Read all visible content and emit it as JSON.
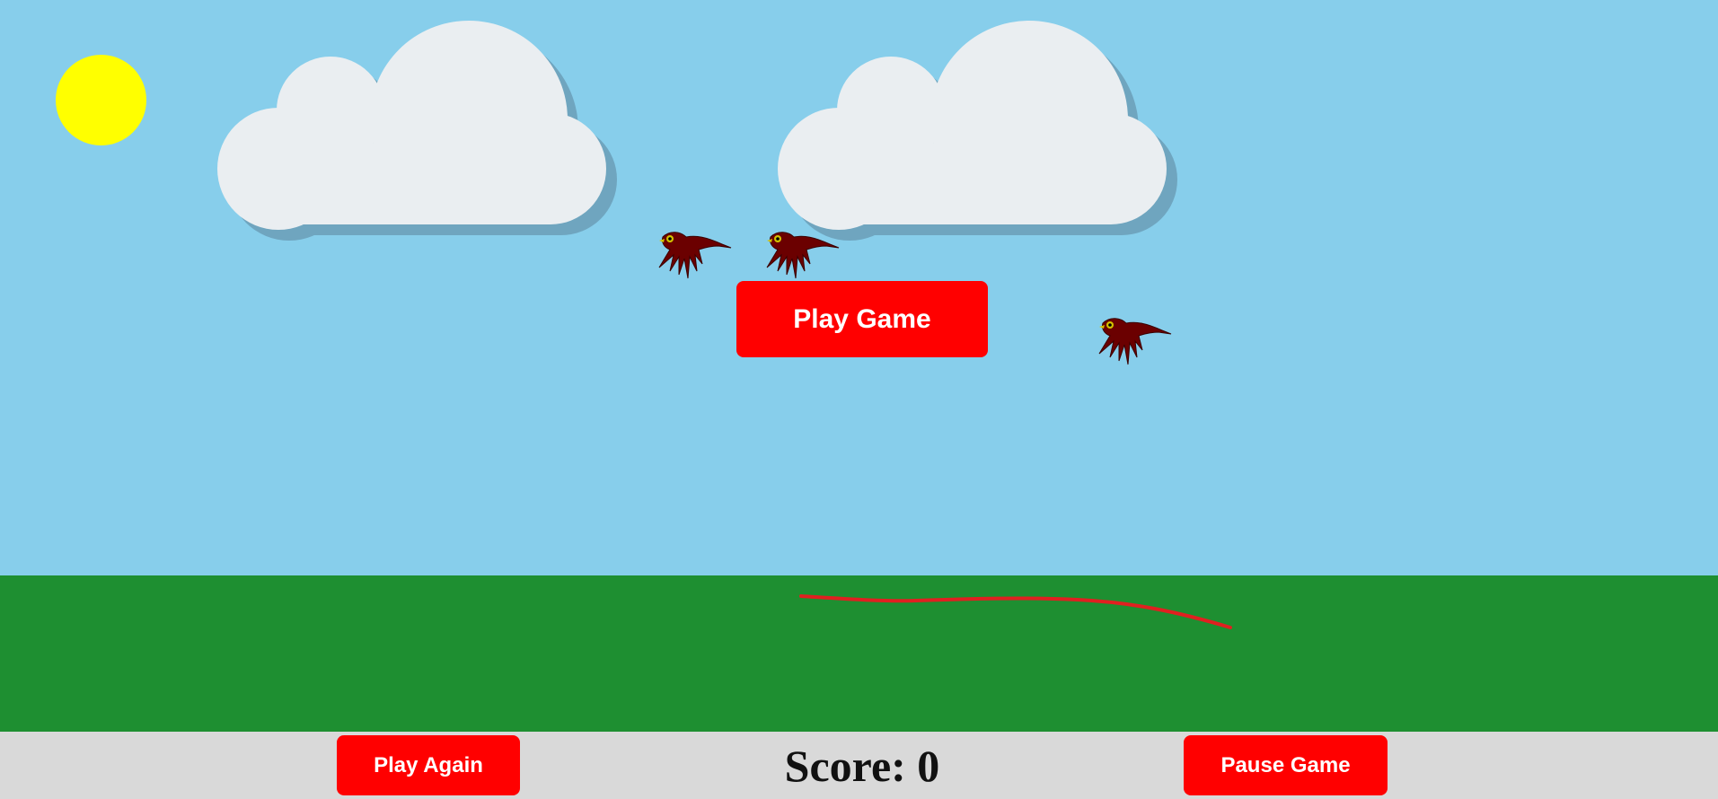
{
  "buttons": {
    "play_game": "Play Game",
    "play_again": "Play Again",
    "pause_game": "Pause Game"
  },
  "score": {
    "label": "Score:",
    "value": "0",
    "text": "Score: 0"
  },
  "scene": {
    "sky_color": "#87ceeb",
    "ground_color": "#1e8f31",
    "footer_color": "#d9d9d9",
    "sun_color": "#ffff00",
    "cloud_color": "#eaeef1",
    "cloud_shadow_color": "#6fa5bf",
    "bird_color": "#6b0000",
    "bird_count": 3,
    "trail_color": "#e02020",
    "button_color": "#ff0000"
  },
  "icons": {
    "sun": "sun-icon",
    "cloud": "cloud-icon",
    "bird": "bird-icon"
  }
}
